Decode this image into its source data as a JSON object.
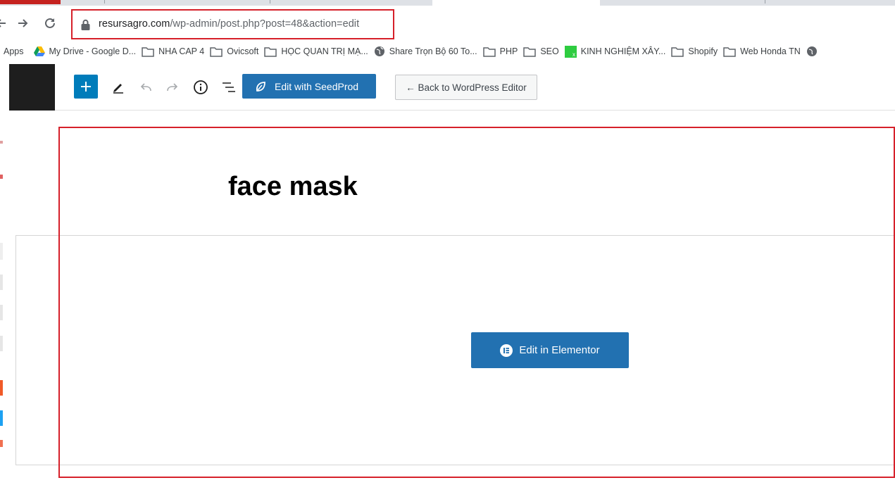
{
  "browser": {
    "url_host": "resursagro.com",
    "url_path": "/wp-admin/post.php?post=48&action=edit"
  },
  "bookmarks": [
    {
      "label": "Apps",
      "icon": "apps-grid-icon"
    },
    {
      "label": "My Drive - Google D...",
      "icon": "google-drive-icon"
    },
    {
      "label": "NHA CAP 4",
      "icon": "folder-icon"
    },
    {
      "label": "Ovicsoft",
      "icon": "folder-icon"
    },
    {
      "label": "HỌC QUAN TRỊ MẠ...",
      "icon": "folder-icon"
    },
    {
      "label": "Share Trọn Bộ 60 To...",
      "icon": "globe-icon"
    },
    {
      "label": "PHP",
      "icon": "folder-icon"
    },
    {
      "label": "SEO",
      "icon": "folder-icon"
    },
    {
      "label": "KINH NGHIỆM XÂY...",
      "icon": "green-square-icon"
    },
    {
      "label": "Shopify",
      "icon": "folder-icon"
    },
    {
      "label": "Web Honda TN",
      "icon": "folder-icon"
    }
  ],
  "editor": {
    "seedprod_label": "Edit with SeedProd",
    "back_label": "← Back to WordPress Editor",
    "post_title": "face mask",
    "elementor_label": "Edit in Elementor"
  },
  "colors": {
    "wp_blue": "#2271b1",
    "add_blue": "#007cba",
    "highlight_red": "#d6202a"
  }
}
